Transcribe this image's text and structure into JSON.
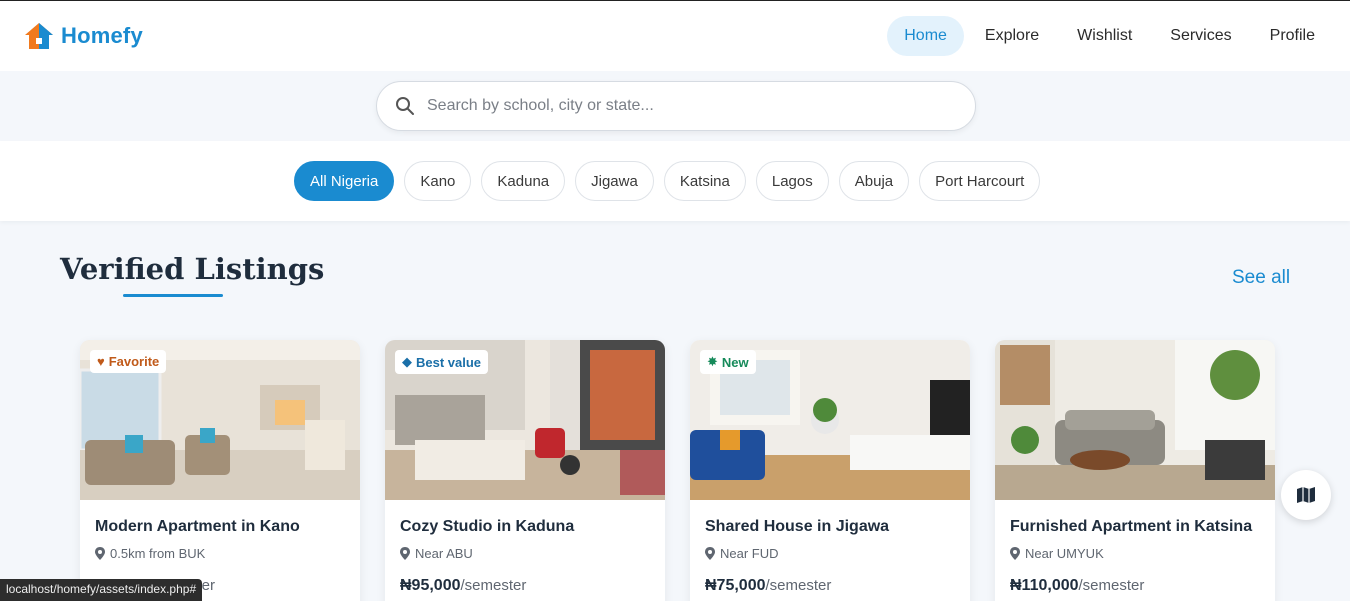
{
  "brand": {
    "name": "Homefy",
    "accent": "#1a8bd0"
  },
  "nav": {
    "items": [
      {
        "label": "Home",
        "active": true
      },
      {
        "label": "Explore"
      },
      {
        "label": "Wishlist"
      },
      {
        "label": "Services"
      },
      {
        "label": "Profile"
      }
    ]
  },
  "search": {
    "placeholder": "Search by school, city or state...",
    "icon": "search-icon"
  },
  "filters": [
    "All Nigeria",
    "Kano",
    "Kaduna",
    "Jigawa",
    "Katsina",
    "Lagos",
    "Abuja",
    "Port Harcourt"
  ],
  "section": {
    "title": "Verified Listings",
    "see_all": "See all"
  },
  "listings": [
    {
      "badge": "Favorite",
      "badge_icon": "heart-icon",
      "badge_color": "#c05a1a",
      "title": "Modern Apartment in Kano",
      "location": "0.5km from BUK",
      "price": "",
      "unit": "ster"
    },
    {
      "badge": "Best value",
      "badge_icon": "tag-icon",
      "badge_color": "#1a6fa8",
      "title": "Cozy Studio in Kaduna",
      "location": "Near ABU",
      "price": "₦95,000",
      "unit": "/semester"
    },
    {
      "badge": "New",
      "badge_icon": "star-badge-icon",
      "badge_color": "#168a5a",
      "title": "Shared House in Jigawa",
      "location": "Near FUD",
      "price": "₦75,000",
      "unit": "/semester"
    },
    {
      "badge": "",
      "badge_icon": "",
      "badge_color": "",
      "title": "Furnished Apartment in Katsina",
      "location": "Near UMYUK",
      "price": "₦110,000",
      "unit": "/semester"
    }
  ],
  "map_button_icon": "map-icon",
  "status_url": "localhost/homefy/assets/index.php#"
}
